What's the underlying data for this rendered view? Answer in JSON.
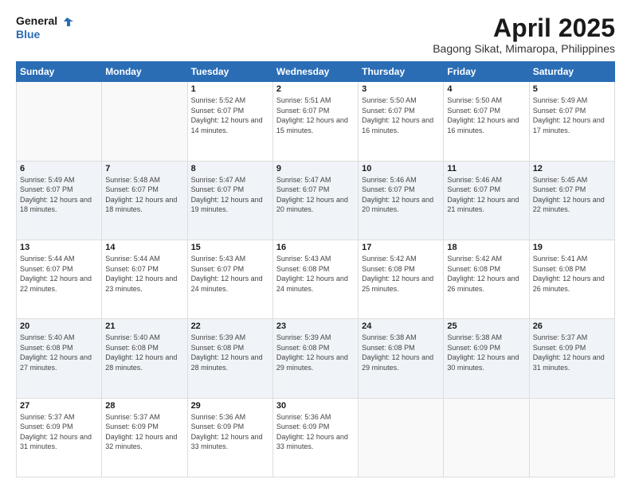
{
  "header": {
    "logo_line1": "General",
    "logo_line2": "Blue",
    "title": "April 2025",
    "subtitle": "Bagong Sikat, Mimaropa, Philippines"
  },
  "weekdays": [
    "Sunday",
    "Monday",
    "Tuesday",
    "Wednesday",
    "Thursday",
    "Friday",
    "Saturday"
  ],
  "weeks": [
    [
      {
        "day": "",
        "info": ""
      },
      {
        "day": "",
        "info": ""
      },
      {
        "day": "1",
        "info": "Sunrise: 5:52 AM\nSunset: 6:07 PM\nDaylight: 12 hours and 14 minutes."
      },
      {
        "day": "2",
        "info": "Sunrise: 5:51 AM\nSunset: 6:07 PM\nDaylight: 12 hours and 15 minutes."
      },
      {
        "day": "3",
        "info": "Sunrise: 5:50 AM\nSunset: 6:07 PM\nDaylight: 12 hours and 16 minutes."
      },
      {
        "day": "4",
        "info": "Sunrise: 5:50 AM\nSunset: 6:07 PM\nDaylight: 12 hours and 16 minutes."
      },
      {
        "day": "5",
        "info": "Sunrise: 5:49 AM\nSunset: 6:07 PM\nDaylight: 12 hours and 17 minutes."
      }
    ],
    [
      {
        "day": "6",
        "info": "Sunrise: 5:49 AM\nSunset: 6:07 PM\nDaylight: 12 hours and 18 minutes."
      },
      {
        "day": "7",
        "info": "Sunrise: 5:48 AM\nSunset: 6:07 PM\nDaylight: 12 hours and 18 minutes."
      },
      {
        "day": "8",
        "info": "Sunrise: 5:47 AM\nSunset: 6:07 PM\nDaylight: 12 hours and 19 minutes."
      },
      {
        "day": "9",
        "info": "Sunrise: 5:47 AM\nSunset: 6:07 PM\nDaylight: 12 hours and 20 minutes."
      },
      {
        "day": "10",
        "info": "Sunrise: 5:46 AM\nSunset: 6:07 PM\nDaylight: 12 hours and 20 minutes."
      },
      {
        "day": "11",
        "info": "Sunrise: 5:46 AM\nSunset: 6:07 PM\nDaylight: 12 hours and 21 minutes."
      },
      {
        "day": "12",
        "info": "Sunrise: 5:45 AM\nSunset: 6:07 PM\nDaylight: 12 hours and 22 minutes."
      }
    ],
    [
      {
        "day": "13",
        "info": "Sunrise: 5:44 AM\nSunset: 6:07 PM\nDaylight: 12 hours and 22 minutes."
      },
      {
        "day": "14",
        "info": "Sunrise: 5:44 AM\nSunset: 6:07 PM\nDaylight: 12 hours and 23 minutes."
      },
      {
        "day": "15",
        "info": "Sunrise: 5:43 AM\nSunset: 6:07 PM\nDaylight: 12 hours and 24 minutes."
      },
      {
        "day": "16",
        "info": "Sunrise: 5:43 AM\nSunset: 6:08 PM\nDaylight: 12 hours and 24 minutes."
      },
      {
        "day": "17",
        "info": "Sunrise: 5:42 AM\nSunset: 6:08 PM\nDaylight: 12 hours and 25 minutes."
      },
      {
        "day": "18",
        "info": "Sunrise: 5:42 AM\nSunset: 6:08 PM\nDaylight: 12 hours and 26 minutes."
      },
      {
        "day": "19",
        "info": "Sunrise: 5:41 AM\nSunset: 6:08 PM\nDaylight: 12 hours and 26 minutes."
      }
    ],
    [
      {
        "day": "20",
        "info": "Sunrise: 5:40 AM\nSunset: 6:08 PM\nDaylight: 12 hours and 27 minutes."
      },
      {
        "day": "21",
        "info": "Sunrise: 5:40 AM\nSunset: 6:08 PM\nDaylight: 12 hours and 28 minutes."
      },
      {
        "day": "22",
        "info": "Sunrise: 5:39 AM\nSunset: 6:08 PM\nDaylight: 12 hours and 28 minutes."
      },
      {
        "day": "23",
        "info": "Sunrise: 5:39 AM\nSunset: 6:08 PM\nDaylight: 12 hours and 29 minutes."
      },
      {
        "day": "24",
        "info": "Sunrise: 5:38 AM\nSunset: 6:08 PM\nDaylight: 12 hours and 29 minutes."
      },
      {
        "day": "25",
        "info": "Sunrise: 5:38 AM\nSunset: 6:09 PM\nDaylight: 12 hours and 30 minutes."
      },
      {
        "day": "26",
        "info": "Sunrise: 5:37 AM\nSunset: 6:09 PM\nDaylight: 12 hours and 31 minutes."
      }
    ],
    [
      {
        "day": "27",
        "info": "Sunrise: 5:37 AM\nSunset: 6:09 PM\nDaylight: 12 hours and 31 minutes."
      },
      {
        "day": "28",
        "info": "Sunrise: 5:37 AM\nSunset: 6:09 PM\nDaylight: 12 hours and 32 minutes."
      },
      {
        "day": "29",
        "info": "Sunrise: 5:36 AM\nSunset: 6:09 PM\nDaylight: 12 hours and 33 minutes."
      },
      {
        "day": "30",
        "info": "Sunrise: 5:36 AM\nSunset: 6:09 PM\nDaylight: 12 hours and 33 minutes."
      },
      {
        "day": "",
        "info": ""
      },
      {
        "day": "",
        "info": ""
      },
      {
        "day": "",
        "info": ""
      }
    ]
  ]
}
